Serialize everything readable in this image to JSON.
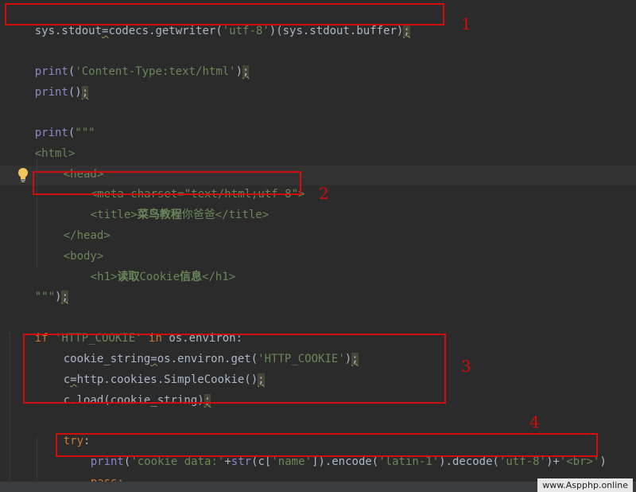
{
  "code": {
    "l1": {
      "a": "sys.stdout",
      "b": "=",
      "c": "codecs.getwriter(",
      "d": "'utf-8'",
      "e": ")(sys.stdout.buffer)",
      "f": ";"
    },
    "l3": {
      "a": "print",
      "b": "(",
      "c": "'Content-Type:text/html'",
      "d": ")",
      "e": ";"
    },
    "l4": {
      "a": "print",
      "b": "()",
      "c": ";"
    },
    "l6": {
      "a": "print",
      "b": "(",
      "c": "\"\"\""
    },
    "l7": "<html>",
    "l8": "<head>",
    "l9": "<meta charset=\"text/html;utf-8\">",
    "l10": {
      "open": "<title>",
      "cjk_a": "菜鸟教程",
      "cjk_b": "你爸爸",
      "close": "</title>"
    },
    "l11": "</head>",
    "l12": "<body>",
    "l13": {
      "open": "<h1>",
      "cjk_a": "读取",
      "mid": "Cookie",
      "cjk_b": "信息",
      "close": "</h1>"
    },
    "l14": {
      "a": "\"\"\"",
      "b": ")",
      "c": ";"
    },
    "l16": {
      "kw_if": "if",
      "s": "'HTTP_COOKIE'",
      "kw_in": "in",
      "rest": "os.environ:"
    },
    "l17": {
      "a": "cookie_string",
      "b": "=",
      "c": "os.environ.get(",
      "d": "'HTTP_COOKIE'",
      "e": ")",
      "f": ";"
    },
    "l18": {
      "a": "c",
      "b": "=",
      "c": "http.cookies.SimpleCookie()",
      "d": ";"
    },
    "l19": {
      "a": "c.load(cookie_string)",
      "b": ";"
    },
    "l21": {
      "kw": "try",
      "colon": ":"
    },
    "l22": {
      "print": "print",
      "p1": "(",
      "s1": "'cookie data:'",
      "plus1": "+",
      "str": "str",
      "p2": "(c[",
      "s2": "'name'",
      "p3": "]).encode(",
      "s3": "'latin-1'",
      "p4": ").decode(",
      "s4": "'utf-8'",
      "p5": ")+",
      "s5": "'<br>'",
      "p6": ")"
    },
    "l23": {
      "kw": "pass",
      "semi": ";"
    }
  },
  "annotations": {
    "n1": "1",
    "n2": "2",
    "n3": "3",
    "n4": "4"
  },
  "watermark": "www.Aspphp.online",
  "colors": {
    "background": "#2b2b2b",
    "keyword": "#cc7832",
    "string": "#6a8759",
    "tag": "#e8bf6a",
    "annotation": "#d10d0d"
  },
  "icons": {
    "intention": "lightbulb-icon"
  }
}
